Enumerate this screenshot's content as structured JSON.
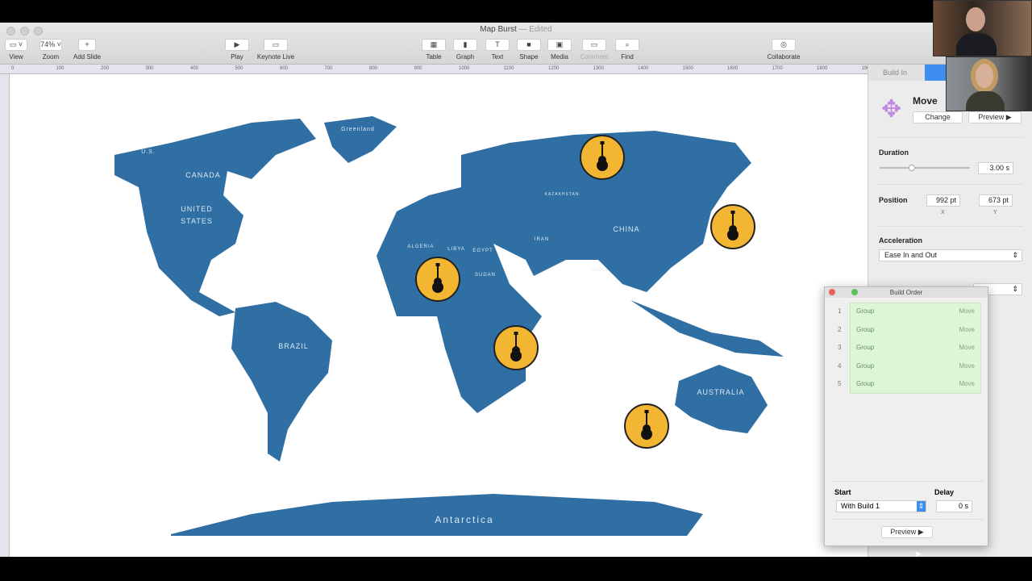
{
  "window": {
    "title": "Map Burst",
    "status": "— Edited"
  },
  "toolbar": [
    {
      "label": "View",
      "icon": "▭ ˅"
    },
    {
      "label": "Zoom",
      "icon": "74% ˅"
    },
    {
      "label": "Add Slide",
      "icon": "+"
    },
    {
      "label": "Play",
      "icon": "▶"
    },
    {
      "label": "Keynote Live",
      "icon": "▭"
    },
    {
      "label": "Table",
      "icon": "▦"
    },
    {
      "label": "Graph",
      "icon": "▮"
    },
    {
      "label": "Text",
      "icon": "T"
    },
    {
      "label": "Shape",
      "icon": "■"
    },
    {
      "label": "Media",
      "icon": "▣"
    },
    {
      "label": "Comment",
      "icon": "▭"
    },
    {
      "label": "Find",
      "icon": "⌕"
    },
    {
      "label": "Collaborate",
      "icon": "◎"
    }
  ],
  "ruler": [
    "0",
    "100",
    "200",
    "300",
    "400",
    "500",
    "600",
    "700",
    "800",
    "900",
    "1000",
    "1100",
    "1200",
    "1300",
    "1400",
    "1500",
    "1600",
    "1700",
    "1800",
    "190"
  ],
  "map": {
    "labels": [
      "Greenland",
      "U.S.",
      "CANADA",
      "UNITED",
      "STATES",
      "BRAZIL",
      "ALGERIA",
      "LIBYA",
      "EGYPT",
      "SUDAN",
      "KAZAKHSTAN",
      "IRAN",
      "CHINA",
      "INDIA",
      "AUSTRALIA",
      "Antarctica"
    ],
    "land_color": "#2f6fa3",
    "marker_color": "#f2b632",
    "marker_icon": "guitar-icon"
  },
  "inspector": {
    "tab": "Build In",
    "effect": "Move",
    "change": "Change",
    "preview": "Preview ▶",
    "duration_label": "Duration",
    "duration": "3.00 s",
    "duration_fraction": 0.2,
    "position_label": "Position",
    "x": "992 pt",
    "y": "673 pt",
    "x_label": "X",
    "y_label": "Y",
    "accel_label": "Acceleration",
    "accel": "Ease In and Out"
  },
  "build_order": {
    "title": "Build Order",
    "items": [
      {
        "n": "1",
        "name": "Group",
        "effect": "Move"
      },
      {
        "n": "2",
        "name": "Group",
        "effect": "Move"
      },
      {
        "n": "3",
        "name": "Group",
        "effect": "Move"
      },
      {
        "n": "4",
        "name": "Group",
        "effect": "Move"
      },
      {
        "n": "5",
        "name": "Group",
        "effect": "Move"
      }
    ],
    "start_label": "Start",
    "start": "With Build 1",
    "delay_label": "Delay",
    "delay": "0 s",
    "preview": "Preview ▶"
  }
}
